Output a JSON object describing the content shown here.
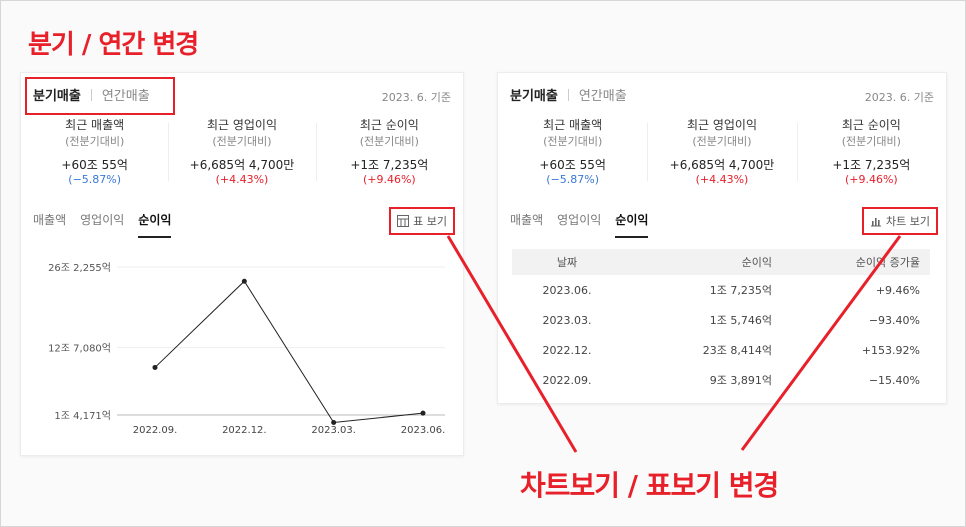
{
  "annotations": {
    "top_title": "분기 / 연간 변경",
    "bottom_title": "차트보기 / 표보기 변경"
  },
  "left_panel": {
    "segment": {
      "active": "분기매출",
      "inactive": "연간매출"
    },
    "basis": "2023. 6. 기준",
    "kpis": [
      {
        "title": "최근 매출액",
        "sub": "(전분기대비)",
        "value": "+60조 55억",
        "delta": "(−5.87%)",
        "trend": "down"
      },
      {
        "title": "최근 영업이익",
        "sub": "(전분기대비)",
        "value": "+6,685억 4,700만",
        "delta": "(+4.43%)",
        "trend": "up"
      },
      {
        "title": "최근 순이익",
        "sub": "(전분기대비)",
        "value": "+1조 7,235억",
        "delta": "(+9.46%)",
        "trend": "up"
      }
    ],
    "tabs": [
      "매출액",
      "영업이익",
      "순이익"
    ],
    "active_tab": "순이익",
    "toggle_label": "표 보기",
    "toggle_icon": "table-icon"
  },
  "right_panel": {
    "segment": {
      "active": "분기매출",
      "inactive": "연간매출"
    },
    "basis": "2023. 6. 기준",
    "kpis": [
      {
        "title": "최근 매출액",
        "sub": "(전분기대비)",
        "value": "+60조 55억",
        "delta": "(−5.87%)",
        "trend": "down"
      },
      {
        "title": "최근 영업이익",
        "sub": "(전분기대비)",
        "value": "+6,685억 4,700만",
        "delta": "(+4.43%)",
        "trend": "up"
      },
      {
        "title": "최근 순이익",
        "sub": "(전분기대비)",
        "value": "+1조 7,235억",
        "delta": "(+9.46%)",
        "trend": "up"
      }
    ],
    "tabs": [
      "매출액",
      "영업이익",
      "순이익"
    ],
    "active_tab": "순이익",
    "toggle_label": "차트 보기",
    "toggle_icon": "bar-chart-icon",
    "table": {
      "headers": [
        "날짜",
        "순이익",
        "순이익 증가율"
      ],
      "rows": [
        {
          "date": "2023.06.",
          "value": "1조 7,235억",
          "growth": "+9.46%",
          "trend": "up"
        },
        {
          "date": "2023.03.",
          "value": "1조 5,746억",
          "growth": "−93.40%",
          "trend": "down"
        },
        {
          "date": "2022.12.",
          "value": "23조 8,414억",
          "growth": "+153.92%",
          "trend": "up"
        },
        {
          "date": "2022.09.",
          "value": "9조 3,891억",
          "growth": "−15.40%",
          "trend": "down"
        }
      ]
    }
  },
  "chart_data": {
    "type": "line",
    "categories": [
      "2022.09.",
      "2022.12.",
      "2023.03.",
      "2023.06."
    ],
    "series": [
      {
        "values": [
          9.3891,
          23.8414,
          0.15746,
          1.7235
        ]
      }
    ],
    "y_ticks": [
      {
        "value": 1.4171,
        "label": "1조 4,171억"
      },
      {
        "value": 12.708,
        "label": "12조 7,080억"
      },
      {
        "value": 26.2255,
        "label": "26조 2,255억"
      }
    ],
    "ylim": [
      1.4171,
      26.2255
    ],
    "grid": true,
    "line_color": "#222222",
    "grid_color": "#eeeeee"
  },
  "colors": {
    "accent": "#e8202a",
    "negative": "#3a78d8",
    "positive": "#e8202a"
  }
}
